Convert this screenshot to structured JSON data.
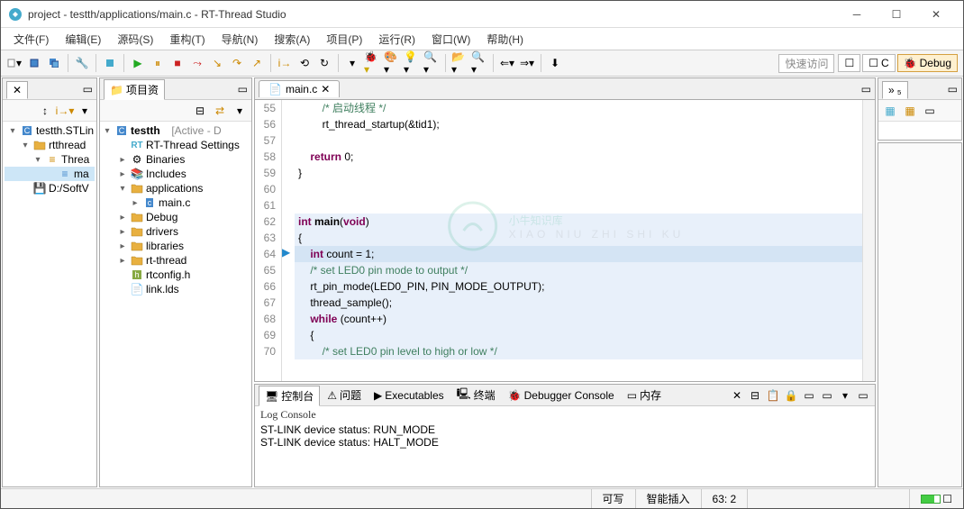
{
  "window": {
    "title": "project - testth/applications/main.c - RT-Thread Studio"
  },
  "menus": [
    "文件(F)",
    "编辑(E)",
    "源码(S)",
    "重构(T)",
    "导航(N)",
    "搜索(A)",
    "项目(P)",
    "运行(R)",
    "窗口(W)",
    "帮助(H)"
  ],
  "toolbar": {
    "quick": "快速访问",
    "persp_c": "C",
    "persp_debug": "Debug"
  },
  "leftPanel": {
    "tree": [
      {
        "indent": 0,
        "arrow": "▾",
        "icon": "c-proj",
        "label": "testth.STLin"
      },
      {
        "indent": 1,
        "arrow": "▾",
        "icon": "folder",
        "label": "rtthread"
      },
      {
        "indent": 2,
        "arrow": "▾",
        "icon": "thread",
        "label": "Threa"
      },
      {
        "indent": 3,
        "arrow": "",
        "icon": "eq",
        "label": "ma",
        "sel": true
      },
      {
        "indent": 1,
        "arrow": "",
        "icon": "drive",
        "label": "D:/SoftV"
      }
    ]
  },
  "projPanel": {
    "title": "项目资",
    "root": {
      "label": "testth",
      "suffix": "[Active - D"
    },
    "items": [
      {
        "indent": 1,
        "arrow": "",
        "icon": "rt",
        "label": "RT-Thread Settings"
      },
      {
        "indent": 1,
        "arrow": "▸",
        "icon": "bin",
        "label": "Binaries"
      },
      {
        "indent": 1,
        "arrow": "▸",
        "icon": "inc",
        "label": "Includes"
      },
      {
        "indent": 1,
        "arrow": "▾",
        "icon": "src",
        "label": "applications"
      },
      {
        "indent": 2,
        "arrow": "▸",
        "icon": "cfile",
        "label": "main.c"
      },
      {
        "indent": 1,
        "arrow": "▸",
        "icon": "src",
        "label": "Debug"
      },
      {
        "indent": 1,
        "arrow": "▸",
        "icon": "src",
        "label": "drivers"
      },
      {
        "indent": 1,
        "arrow": "▸",
        "icon": "src",
        "label": "libraries"
      },
      {
        "indent": 1,
        "arrow": "▸",
        "icon": "src",
        "label": "rt-thread"
      },
      {
        "indent": 1,
        "arrow": "",
        "icon": "hfile",
        "label": "rtconfig.h"
      },
      {
        "indent": 1,
        "arrow": "",
        "icon": "file",
        "label": "link.lds"
      }
    ]
  },
  "editor": {
    "tab": "main.c",
    "lines": [
      {
        "n": 55,
        "html": "        <span class='com'>/* 启动线程 */</span>"
      },
      {
        "n": 56,
        "html": "        rt_thread_startup(&tid1);"
      },
      {
        "n": 57,
        "html": ""
      },
      {
        "n": 58,
        "html": "    <span class='kw'>return</span> 0;"
      },
      {
        "n": 59,
        "html": "}"
      },
      {
        "n": 60,
        "html": ""
      },
      {
        "n": 61,
        "html": ""
      },
      {
        "n": 62,
        "html": "<span class='kw'>int</span> <span style='font-weight:bold'>main</span>(<span class='kw'>void</span>)",
        "hl": true
      },
      {
        "n": 63,
        "html": "{",
        "hl": true
      },
      {
        "n": 64,
        "html": "    <span class='kw'>int</span> count = 1;",
        "hlcur": true
      },
      {
        "n": 65,
        "html": "    <span class='com'>/* set LED0 pin mode to output */</span>",
        "hl": true
      },
      {
        "n": 66,
        "html": "    rt_pin_mode(LED0_PIN, PIN_MODE_OUTPUT);",
        "hl": true
      },
      {
        "n": 67,
        "html": "    thread_sample();",
        "hl": true
      },
      {
        "n": 68,
        "html": "    <span class='kw'>while</span> (count++)",
        "hl": true
      },
      {
        "n": 69,
        "html": "    {",
        "hl": true
      },
      {
        "n": 70,
        "html": "        <span class='com'>/* set LED0 pin level to high or low */</span>",
        "hl": true
      }
    ],
    "watermark": "小牛知识库",
    "watermark_sub": "XIAO NIU ZHI SHI KU"
  },
  "bottom": {
    "tabs": [
      "控制台",
      "问题",
      "Executables",
      "终端",
      "Debugger Console",
      "内存"
    ],
    "activeTab": 0,
    "header": "Log Console",
    "lines": [
      "ST-LINK device status: RUN_MODE",
      "ST-LINK device status: HALT_MODE"
    ]
  },
  "status": {
    "mode": "可写",
    "insert": "智能插入",
    "pos": "63: 2"
  }
}
